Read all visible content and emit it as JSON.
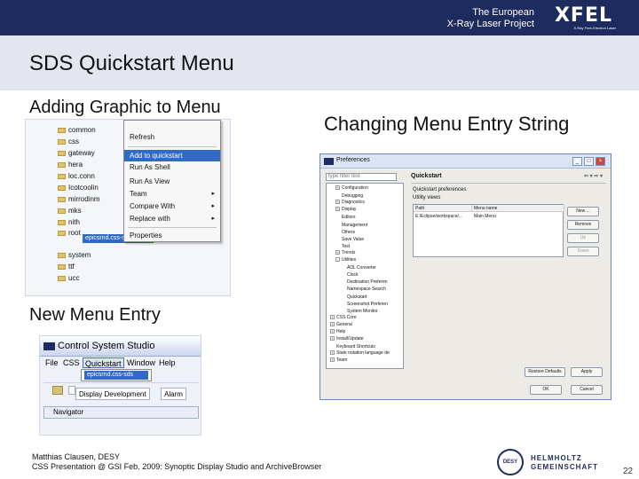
{
  "header": {
    "org_line1": "The European",
    "org_line2": "X-Ray Laser Project",
    "logo": "XFEL",
    "logo_tagline": "X-Ray Free-Electron Laser"
  },
  "title": "SDS Quickstart Menu",
  "sections": {
    "adding_graphic": "Adding Graphic to Menu",
    "changing_entry": "Changing Menu Entry String",
    "new_entry": "New Menu Entry"
  },
  "shot1": {
    "tree": [
      "common",
      "css",
      "gateway",
      "hera",
      "loc.conn",
      "Icotcoolin",
      "mirrodinm",
      "mks",
      "nith",
      "root",
      "system",
      "ttf",
      "ucc"
    ],
    "selected_file": "epicsrnd.css-sds",
    "menu": {
      "items": [
        {
          "label": "Refresh",
          "arrow": ""
        },
        {
          "label": "Add to quickstart",
          "arrow": "",
          "selected": true
        },
        {
          "label": "Run As Shell",
          "arrow": ""
        },
        {
          "label": "Run As View",
          "arrow": ""
        },
        {
          "label": "Team",
          "arrow": "▸"
        },
        {
          "label": "Compare With",
          "arrow": "▸"
        },
        {
          "label": "Replace with",
          "arrow": "▸"
        },
        {
          "label": "Properties",
          "arrow": ""
        }
      ]
    }
  },
  "shot2": {
    "window_title": "Preferences",
    "filter_placeholder": "type filter text",
    "tree": [
      {
        "label": "Configuration",
        "level": 1,
        "toggle": "+"
      },
      {
        "label": "Debugging",
        "level": 1,
        "toggle": ""
      },
      {
        "label": "Diagnostics",
        "level": 1,
        "toggle": "+"
      },
      {
        "label": "Display",
        "level": 1,
        "toggle": "+"
      },
      {
        "label": "Editors",
        "level": 1,
        "toggle": ""
      },
      {
        "label": "Management",
        "level": 1,
        "toggle": ""
      },
      {
        "label": "Others",
        "level": 1,
        "toggle": ""
      },
      {
        "label": "Save Value",
        "level": 1,
        "toggle": ""
      },
      {
        "label": "Test",
        "level": 1,
        "toggle": ""
      },
      {
        "label": "Trends",
        "level": 1,
        "toggle": "+"
      },
      {
        "label": "Utilities",
        "level": 1,
        "toggle": "-"
      },
      {
        "label": "ADL Converter",
        "level": 2,
        "toggle": ""
      },
      {
        "label": "Clock",
        "level": 2,
        "toggle": ""
      },
      {
        "label": "Destination Preferen",
        "level": 2,
        "toggle": ""
      },
      {
        "label": "Namespace Search",
        "level": 2,
        "toggle": ""
      },
      {
        "label": "Quickstart",
        "level": 2,
        "toggle": ""
      },
      {
        "label": "Screenshot Preferen",
        "level": 2,
        "toggle": ""
      },
      {
        "label": "System Monitor",
        "level": 2,
        "toggle": ""
      },
      {
        "label": "CSS Core",
        "level": 0,
        "toggle": "+"
      },
      {
        "label": "General",
        "level": 0,
        "toggle": "+"
      },
      {
        "label": "Help",
        "level": 0,
        "toggle": "+"
      },
      {
        "label": "Install/Update",
        "level": 0,
        "toggle": "+"
      },
      {
        "label": "Keyboard Shortcuts",
        "level": 0,
        "toggle": ""
      },
      {
        "label": "State notation language de",
        "level": 0,
        "toggle": "+"
      },
      {
        "label": "Team",
        "level": 0,
        "toggle": "+"
      }
    ],
    "panel_title": "Quickstart",
    "panel_line1": "Quickstart preferences",
    "panel_line2": "Utility views",
    "table_headers": [
      "Path",
      "Menu name"
    ],
    "table_row": [
      "E:/Eclipse/workspace/...",
      "Main Menu"
    ],
    "buttons": {
      "new": "New ...",
      "remove": "Remove",
      "up": "Up",
      "down": "Down",
      "restore": "Restore Defaults",
      "apply": "Apply",
      "ok": "OK",
      "cancel": "Cancel"
    }
  },
  "shot3": {
    "window_title": "Control System Studio",
    "menu": [
      "File",
      "CSS",
      "Quickstart",
      "Window",
      "Help"
    ],
    "menu_entry": "epicsrnd.css-sds",
    "tab1": "Display Development",
    "tab2": "Alarm",
    "navigator": "Navigator"
  },
  "footer": {
    "author": "Matthias Clausen, DESY",
    "presentation": "CSS Presentation @ GSI Feb. 2009: Synoptic Display Studio and ArchiveBrowser",
    "desy": "DESY",
    "helmholtz1": "HELMHOLTZ",
    "helmholtz2": "GEMEINSCHAFT",
    "page": "22"
  }
}
